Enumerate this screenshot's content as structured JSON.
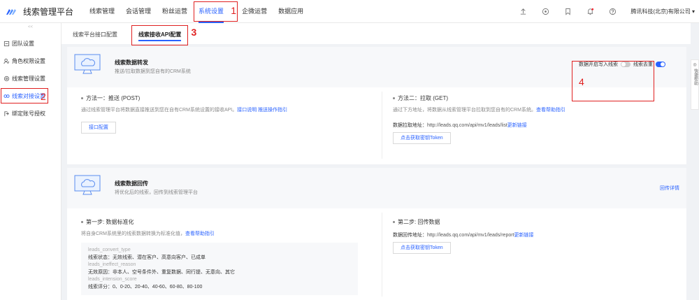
{
  "app": {
    "title": "线索管理平台"
  },
  "nav": [
    {
      "label": "线索管理"
    },
    {
      "label": "会话管理"
    },
    {
      "label": "粉丝运营"
    },
    {
      "label": "系统设置",
      "annotation": "1"
    },
    {
      "label": "企微运营"
    },
    {
      "label": "数据应用"
    }
  ],
  "topbar": {
    "icons": [
      "upload-icon",
      "gift-icon",
      "bookmark-icon",
      "bell-icon",
      "help-icon"
    ],
    "company": "腾讯科技(北京)有限公司"
  },
  "sidebar": {
    "collapse": "<<",
    "items": [
      {
        "label": "团队设置",
        "icon": "team-icon"
      },
      {
        "label": "角色权限设置",
        "icon": "role-icon"
      },
      {
        "label": "线索管理设置",
        "icon": "settings-icon"
      },
      {
        "label": "线索对接设置",
        "icon": "link-icon",
        "annotation": "2"
      },
      {
        "label": "绑定账号授权",
        "icon": "account-icon"
      }
    ]
  },
  "subtabs": [
    {
      "label": "线索平台接口配置"
    },
    {
      "label": "线索接收API配置",
      "annotation": "3"
    }
  ],
  "push_card": {
    "title": "线索数据转发",
    "desc": "推送/拉取数据到您自有的CRM系统",
    "method1": {
      "title": "方法一：推送 (POST)",
      "desc": "通过线索管理平台将数据直接推送到您在自有CRM系统设置的接收API。",
      "link1": "接口说明",
      "link2": "推送操作指引",
      "button": "接口配置"
    },
    "method2": {
      "title": "方法二：拉取 (GET)",
      "desc": "通过下方地址，将数据从线索管理平台拉取到您自有的CRM系统。",
      "link": "查看帮助指引",
      "addr_label": "数据拉取地址：",
      "addr": "http://leads.qq.com/api/mv1/leads/list",
      "addr_link": "更新链接",
      "button": "点击获取密钥Token"
    },
    "toggle1_label": "数据开启写入线索",
    "toggle2_label": "线索去重",
    "annotation": "4"
  },
  "return_card": {
    "title": "线索数据回传",
    "desc": "将优化后的线索，回传到线索管理平台",
    "detail_link": "回传详情",
    "step1": {
      "title": "第一步: 数据标准化",
      "desc": "将自身CRM系统里的线索数据转换为标准化值，",
      "link": "查看帮助指引",
      "code": [
        {
          "k": "leads_convert_type",
          "v": ""
        },
        {
          "k": "",
          "v": "线索状态：无效线索、潜在客户、高意向客户、已成单"
        },
        {
          "k": "leads_ineffect_reason",
          "v": ""
        },
        {
          "k": "",
          "v": "无效原因：非本人、空号条件外、重复数据、同行提、无意向、其它"
        },
        {
          "k": "leads_intension_score",
          "v": ""
        },
        {
          "k": "",
          "v": "线索评分：0、0-20、20-40、40-60、60-80、80-100"
        }
      ]
    },
    "step2": {
      "title": "第二步: 回传数据",
      "addr_label": "数据回传地址：",
      "addr": "http://leads.qq.com/api/mv1/leads/report",
      "addr_link": "更新链接",
      "button": "点击获取密钥Token"
    }
  },
  "right_tab": "快捷帮助"
}
